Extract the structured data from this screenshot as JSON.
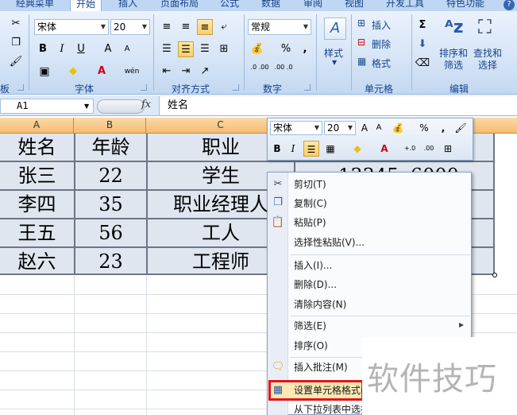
{
  "tabs": [
    "经典菜单",
    "开始",
    "插入",
    "页面布局",
    "公式",
    "数据",
    "审阅",
    "视图",
    "开发工具",
    "特色功能"
  ],
  "active_tab": "开始",
  "help_icon": "?",
  "ribbon": {
    "clipboard": {
      "label": "板"
    },
    "font": {
      "label": "字体",
      "name": "宋体",
      "size": "20",
      "bold": "B",
      "italic": "I",
      "underline": "U",
      "grow": "A",
      "shrink": "A",
      "wen": "wén"
    },
    "alignment": {
      "label": "对齐方式"
    },
    "number": {
      "label": "数字",
      "format": "常规",
      "percent": "%",
      "comma": ",",
      "inc_dec": ".0 .00",
      "dec_dec": ".00 .0"
    },
    "styles": {
      "label": "样式"
    },
    "cells": {
      "label": "单元格",
      "insert": "插入",
      "delete": "删除",
      "format": "格式"
    },
    "editing": {
      "label": "编辑",
      "sum": "Σ",
      "sort_filter": "排序和\n筛选",
      "find_select": "查找和\n选择"
    }
  },
  "formula_bar": {
    "cell_ref": "A1",
    "fx": "fx",
    "content": "姓名"
  },
  "columns": [
    "A",
    "B",
    "C"
  ],
  "table": {
    "header": [
      "姓名",
      "年龄",
      "职业"
    ],
    "rows": [
      [
        "张三",
        "22",
        "学生"
      ],
      [
        "李四",
        "35",
        "职业经理人"
      ],
      [
        "王五",
        "56",
        "工人"
      ],
      [
        "赵六",
        "23",
        "工程师"
      ]
    ],
    "partial_d2": "13345ᴗ6000"
  },
  "mini_toolbar": {
    "font": "宋体",
    "size": "20",
    "percent": "%",
    "comma": ",",
    "bold": "B",
    "italic": "I"
  },
  "context_menu": [
    {
      "label": "剪切(T)",
      "icon": "scissors-icon"
    },
    {
      "label": "复制(C)",
      "icon": "copy-icon"
    },
    {
      "label": "粘贴(P)",
      "icon": "paste-icon"
    },
    {
      "label": "选择性粘贴(V)..."
    },
    {
      "label": "插入(I)..."
    },
    {
      "label": "删除(D)..."
    },
    {
      "label": "清除内容(N)"
    },
    {
      "label": "筛选(E)"
    },
    {
      "label": "排序(O)"
    },
    {
      "label": "插入批注(M)",
      "icon": "comment-icon"
    },
    {
      "label": "设置单元格格式(F)...",
      "icon": "format-cells-icon"
    },
    {
      "label": "从下拉列表中选择(K)..."
    }
  ],
  "watermark": "软件技巧"
}
